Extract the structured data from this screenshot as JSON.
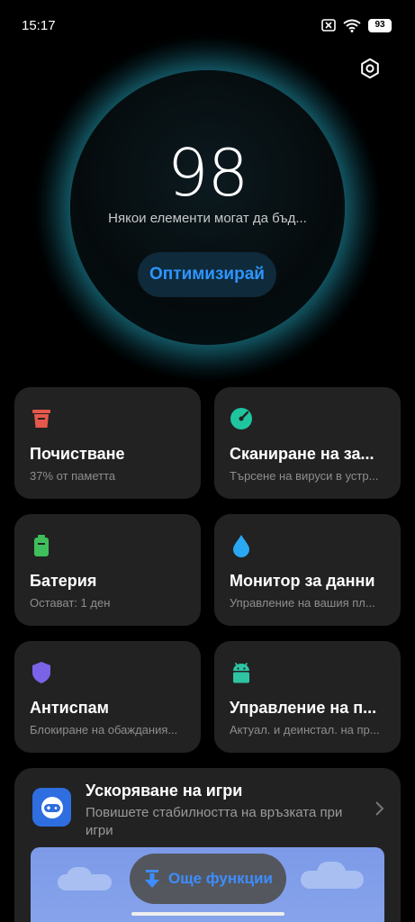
{
  "status_bar": {
    "time": "15:17",
    "battery": "93",
    "icons": [
      "sim-off-icon",
      "wifi-icon",
      "battery-icon"
    ]
  },
  "header": {
    "settings_icon": "gear-icon"
  },
  "hero": {
    "score": "98",
    "subtitle": "Някои елементи могат да бъд...",
    "optimize_label": "Оптимизирай",
    "glow_color": "#2a9bb0"
  },
  "cards": [
    {
      "title": "Почистване",
      "subtitle": "37% от паметта",
      "icon": "trash-icon",
      "color": "#e5584b"
    },
    {
      "title": "Сканиране на за...",
      "subtitle": "Търсене на вируси в устр...",
      "icon": "scan-icon",
      "color": "#1fc59f"
    },
    {
      "title": "Батерия",
      "subtitle": "Остават: 1 ден",
      "icon": "battery-icon",
      "color": "#3fbf5b"
    },
    {
      "title": "Монитор за данни",
      "subtitle": "Управление на вашия пл...",
      "icon": "drop-icon",
      "color": "#2aa7f3"
    },
    {
      "title": "Антиспам",
      "subtitle": "Блокиране на обаждания...",
      "icon": "shield-icon",
      "color": "#7b63e8"
    },
    {
      "title": "Управление на п...",
      "subtitle": "Актуал. и деинстал. на пр...",
      "icon": "android-icon",
      "color": "#2fc3a3"
    }
  ],
  "game_booster": {
    "title": "Ускоряване на игри",
    "subtitle": "Повишете стабилността на връзката при игри",
    "icon": "gamepad-icon"
  },
  "more_button": {
    "label": "Още функции",
    "icon": "download-arrow-icon",
    "color": "#3d8dff"
  }
}
